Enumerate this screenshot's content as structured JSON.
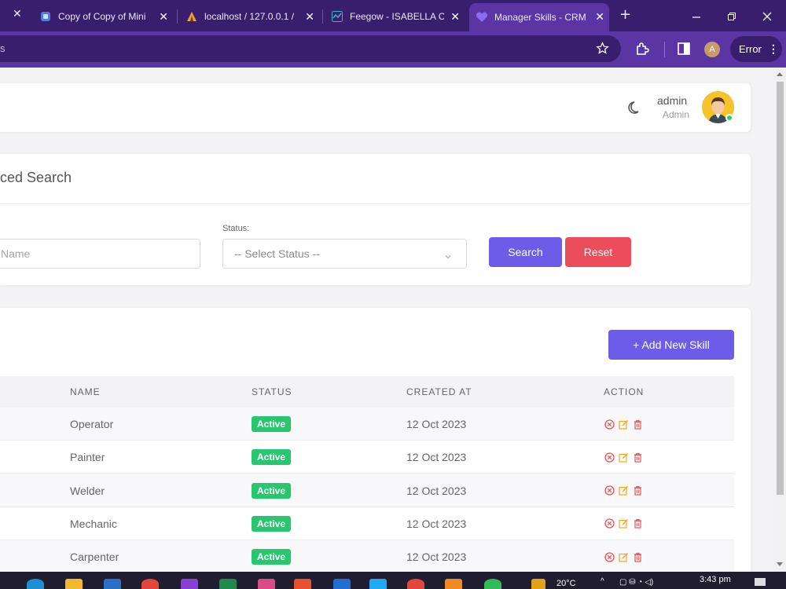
{
  "browser": {
    "tabs": [
      {
        "title": "Copy of Copy of Mini",
        "icon": "doc-icon",
        "active": false
      },
      {
        "title": "localhost / 127.0.0.1 /",
        "icon": "phpmyadmin-icon",
        "active": false
      },
      {
        "title": "Feegow - ISABELLA C",
        "icon": "feegow-icon",
        "active": false
      },
      {
        "title": "Manager Skills - CRM",
        "icon": "heart-icon",
        "active": true
      }
    ],
    "close_glyph": "✕",
    "new_tab_glyph": "+",
    "address_text": "s",
    "profile_initial": "A",
    "error_label": "Error"
  },
  "header": {
    "user_name": "admin",
    "user_role": "Admin"
  },
  "search": {
    "title": "ced Search",
    "name_placeholder": "Name",
    "status_label": "Status:",
    "status_placeholder": "-- Select Status --",
    "search_button": "Search",
    "reset_button": "Reset"
  },
  "table": {
    "add_button": "+ Add New Skill",
    "columns": [
      "NAME",
      "STATUS",
      "CREATED AT",
      "ACTION"
    ],
    "rows": [
      {
        "name": "Operator",
        "status": "Active",
        "created_at": "12 Oct 2023"
      },
      {
        "name": "Painter",
        "status": "Active",
        "created_at": "12 Oct 2023"
      },
      {
        "name": "Welder",
        "status": "Active",
        "created_at": "12 Oct 2023"
      },
      {
        "name": "Mechanic",
        "status": "Active",
        "created_at": "12 Oct 2023"
      },
      {
        "name": "Carpenter",
        "status": "Active",
        "created_at": "12 Oct 2023"
      }
    ]
  },
  "taskbar": {
    "temperature": "20°C",
    "time": "3:43 pm"
  },
  "colors": {
    "primary": "#6c5ce7",
    "danger": "#eb4d5a",
    "success": "#28c76f",
    "browser_frame": "#3a1e6e",
    "browser_active": "#5b35a3"
  }
}
